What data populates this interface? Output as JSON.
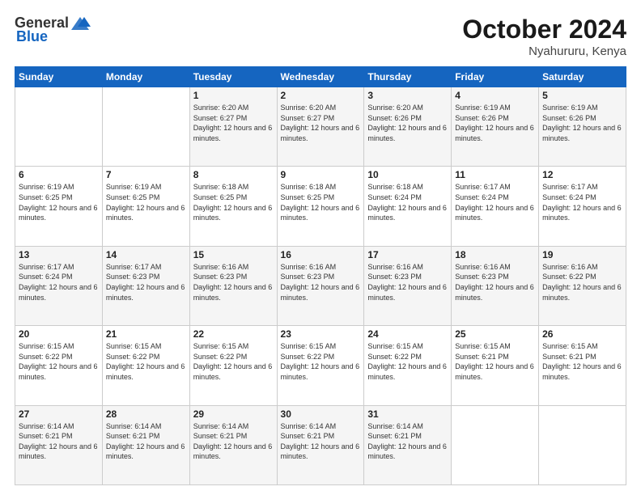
{
  "header": {
    "logo_general": "General",
    "logo_blue": "Blue",
    "month": "October 2024",
    "location": "Nyahururu, Kenya"
  },
  "weekdays": [
    "Sunday",
    "Monday",
    "Tuesday",
    "Wednesday",
    "Thursday",
    "Friday",
    "Saturday"
  ],
  "weeks": [
    [
      {
        "day": "",
        "info": ""
      },
      {
        "day": "",
        "info": ""
      },
      {
        "day": "1",
        "info": "Sunrise: 6:20 AM\nSunset: 6:27 PM\nDaylight: 12 hours and 6 minutes."
      },
      {
        "day": "2",
        "info": "Sunrise: 6:20 AM\nSunset: 6:27 PM\nDaylight: 12 hours and 6 minutes."
      },
      {
        "day": "3",
        "info": "Sunrise: 6:20 AM\nSunset: 6:26 PM\nDaylight: 12 hours and 6 minutes."
      },
      {
        "day": "4",
        "info": "Sunrise: 6:19 AM\nSunset: 6:26 PM\nDaylight: 12 hours and 6 minutes."
      },
      {
        "day": "5",
        "info": "Sunrise: 6:19 AM\nSunset: 6:26 PM\nDaylight: 12 hours and 6 minutes."
      }
    ],
    [
      {
        "day": "6",
        "info": "Sunrise: 6:19 AM\nSunset: 6:25 PM\nDaylight: 12 hours and 6 minutes."
      },
      {
        "day": "7",
        "info": "Sunrise: 6:19 AM\nSunset: 6:25 PM\nDaylight: 12 hours and 6 minutes."
      },
      {
        "day": "8",
        "info": "Sunrise: 6:18 AM\nSunset: 6:25 PM\nDaylight: 12 hours and 6 minutes."
      },
      {
        "day": "9",
        "info": "Sunrise: 6:18 AM\nSunset: 6:25 PM\nDaylight: 12 hours and 6 minutes."
      },
      {
        "day": "10",
        "info": "Sunrise: 6:18 AM\nSunset: 6:24 PM\nDaylight: 12 hours and 6 minutes."
      },
      {
        "day": "11",
        "info": "Sunrise: 6:17 AM\nSunset: 6:24 PM\nDaylight: 12 hours and 6 minutes."
      },
      {
        "day": "12",
        "info": "Sunrise: 6:17 AM\nSunset: 6:24 PM\nDaylight: 12 hours and 6 minutes."
      }
    ],
    [
      {
        "day": "13",
        "info": "Sunrise: 6:17 AM\nSunset: 6:24 PM\nDaylight: 12 hours and 6 minutes."
      },
      {
        "day": "14",
        "info": "Sunrise: 6:17 AM\nSunset: 6:23 PM\nDaylight: 12 hours and 6 minutes."
      },
      {
        "day": "15",
        "info": "Sunrise: 6:16 AM\nSunset: 6:23 PM\nDaylight: 12 hours and 6 minutes."
      },
      {
        "day": "16",
        "info": "Sunrise: 6:16 AM\nSunset: 6:23 PM\nDaylight: 12 hours and 6 minutes."
      },
      {
        "day": "17",
        "info": "Sunrise: 6:16 AM\nSunset: 6:23 PM\nDaylight: 12 hours and 6 minutes."
      },
      {
        "day": "18",
        "info": "Sunrise: 6:16 AM\nSunset: 6:23 PM\nDaylight: 12 hours and 6 minutes."
      },
      {
        "day": "19",
        "info": "Sunrise: 6:16 AM\nSunset: 6:22 PM\nDaylight: 12 hours and 6 minutes."
      }
    ],
    [
      {
        "day": "20",
        "info": "Sunrise: 6:15 AM\nSunset: 6:22 PM\nDaylight: 12 hours and 6 minutes."
      },
      {
        "day": "21",
        "info": "Sunrise: 6:15 AM\nSunset: 6:22 PM\nDaylight: 12 hours and 6 minutes."
      },
      {
        "day": "22",
        "info": "Sunrise: 6:15 AM\nSunset: 6:22 PM\nDaylight: 12 hours and 6 minutes."
      },
      {
        "day": "23",
        "info": "Sunrise: 6:15 AM\nSunset: 6:22 PM\nDaylight: 12 hours and 6 minutes."
      },
      {
        "day": "24",
        "info": "Sunrise: 6:15 AM\nSunset: 6:22 PM\nDaylight: 12 hours and 6 minutes."
      },
      {
        "day": "25",
        "info": "Sunrise: 6:15 AM\nSunset: 6:21 PM\nDaylight: 12 hours and 6 minutes."
      },
      {
        "day": "26",
        "info": "Sunrise: 6:15 AM\nSunset: 6:21 PM\nDaylight: 12 hours and 6 minutes."
      }
    ],
    [
      {
        "day": "27",
        "info": "Sunrise: 6:14 AM\nSunset: 6:21 PM\nDaylight: 12 hours and 6 minutes."
      },
      {
        "day": "28",
        "info": "Sunrise: 6:14 AM\nSunset: 6:21 PM\nDaylight: 12 hours and 6 minutes."
      },
      {
        "day": "29",
        "info": "Sunrise: 6:14 AM\nSunset: 6:21 PM\nDaylight: 12 hours and 6 minutes."
      },
      {
        "day": "30",
        "info": "Sunrise: 6:14 AM\nSunset: 6:21 PM\nDaylight: 12 hours and 6 minutes."
      },
      {
        "day": "31",
        "info": "Sunrise: 6:14 AM\nSunset: 6:21 PM\nDaylight: 12 hours and 6 minutes."
      },
      {
        "day": "",
        "info": ""
      },
      {
        "day": "",
        "info": ""
      }
    ]
  ]
}
